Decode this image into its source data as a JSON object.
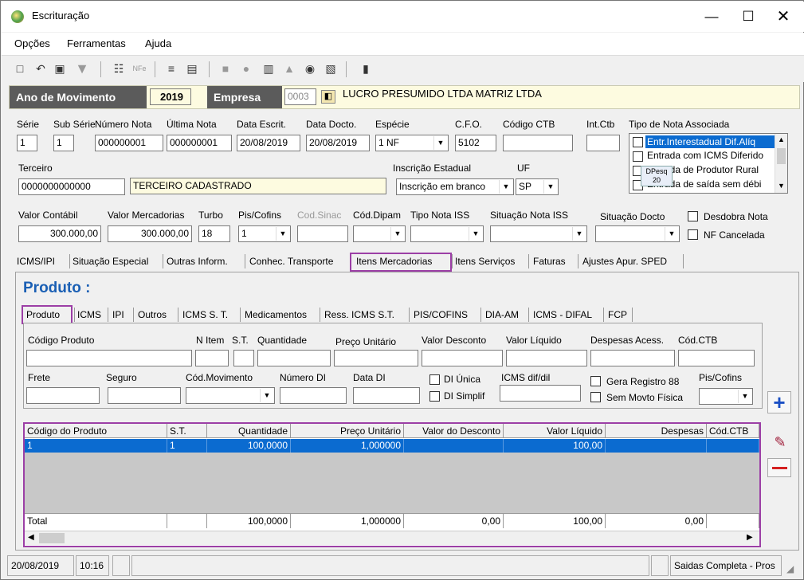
{
  "window": {
    "title": "Escrituração"
  },
  "menu": {
    "opcoes": "Opções",
    "ferramentas": "Ferramentas",
    "ajuda": "Ajuda"
  },
  "header": {
    "ano_label": "Ano de Movimento",
    "ano_value": "2019",
    "empresa_label": "Empresa",
    "empresa_code": "0003",
    "empresa_name": "LUCRO PRESUMIDO LTDA MATRIZ LTDA"
  },
  "form": {
    "serie_label": "Série",
    "serie": "1",
    "subserie_label": "Sub Série",
    "subserie": "1",
    "numero_label": "Número Nota",
    "numero": "000000001",
    "ultima_label": "Última Nota",
    "ultima": "000000001",
    "data_escrit_label": "Data Escrit.",
    "data_escrit": "20/08/2019",
    "data_docto_label": "Data Docto.",
    "data_docto": "20/08/2019",
    "especie_label": "Espécie",
    "especie": "1    NF",
    "cfo_label": "C.F.O.",
    "cfo": "5102",
    "codigo_ctb_label": "Código CTB",
    "codigo_ctb": "",
    "int_ctb_label": "Int.Ctb",
    "int_ctb": "",
    "tipo_nota_label": "Tipo de Nota Associada",
    "tipo_nota_items": [
      "Entr.Interestadual Dif.Alíq",
      "Entrada com ICMS Diferido",
      "Entrada de Produtor Rural",
      "Entrada de saída sem débi"
    ],
    "dpesq_label": "DPesq",
    "dpesq_num": "20",
    "terceiro_label": "Terceiro",
    "terceiro_code": "0000000000000",
    "terceiro_name": "TERCEIRO CADASTRADO",
    "ie_label": "Inscrição Estadual",
    "ie": "Inscrição em branco",
    "uf_label": "UF",
    "uf": "SP",
    "valor_contabil_label": "Valor Contábil",
    "valor_contabil": "300.000,00",
    "valor_merc_label": "Valor Mercadorias",
    "valor_merc": "300.000,00",
    "turbo_label": "Turbo",
    "turbo": "18",
    "pis_label": "Pis/Cofins",
    "pis": "1",
    "cod_sinac_label": "Cod.Sinac",
    "cod_dipam_label": "Cód.Dipam",
    "tipo_iss_label": "Tipo Nota ISS",
    "sit_iss_label": "Situação Nota ISS",
    "sit_docto_label": "Situação Docto",
    "desdobra_label": "Desdobra Nota",
    "nf_cancelada_label": "NF Cancelada"
  },
  "tabs": [
    "ICMS/IPI",
    "Situação Especial",
    "Outras Inform.",
    "Conhec. Transporte",
    "Itens Mercadorias",
    "Itens Serviços",
    "Faturas",
    "Ajustes Apur. SPED"
  ],
  "produto": {
    "title": "Produto :",
    "subtabs": [
      "Produto",
      "ICMS",
      "IPI",
      "Outros",
      "ICMS S. T.",
      "Medicamentos",
      "Ress. ICMS S.T.",
      "PIS/COFINS",
      "DIA-AM",
      "ICMS - DIFAL",
      "FCP"
    ],
    "codigo_label": "Código Produto",
    "nitem_label": "N Item",
    "st_label": "S.T.",
    "quantidade_label": "Quantidade",
    "preco_label": "Preço Unitário",
    "desconto_label": "Valor Desconto",
    "liquido_label": "Valor Líquido",
    "despesas_label": "Despesas Acess.",
    "codctb_label": "Cód.CTB",
    "frete_label": "Frete",
    "seguro_label": "Seguro",
    "codmov_label": "Cód.Movimento",
    "numdi_label": "Número DI",
    "datadi_label": "Data DI",
    "di_unica_label": "DI Única",
    "di_simplif_label": "DI Simplif",
    "icms_difdil_label": "ICMS dif/dil",
    "gera88_label": "Gera Registro 88",
    "sem_movto_label": "Sem Movto Física",
    "piscofins_label": "Pis/Cofins"
  },
  "grid": {
    "headers": [
      "Código do Produto",
      "S.T.",
      "Quantidade",
      "Preço Unitário",
      "Valor do Desconto",
      "Valor Líquido",
      "Despesas",
      "Cód.CTB"
    ],
    "rows": [
      [
        "1",
        "1",
        "100,0000",
        "1,000000",
        "",
        "100,00",
        "",
        ""
      ]
    ],
    "total_label": "Total",
    "totals": [
      "",
      "100,0000",
      "1,000000",
      "0,00",
      "100,00",
      "0,00",
      ""
    ]
  },
  "status": {
    "date": "20/08/2019",
    "time": "10:16",
    "mode": "Saidas Completa - Pros"
  }
}
